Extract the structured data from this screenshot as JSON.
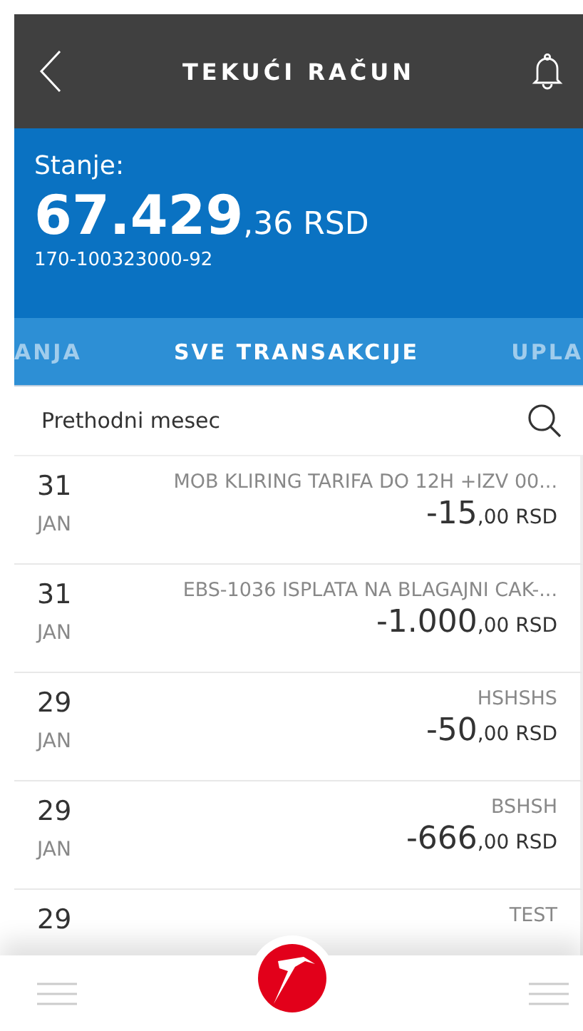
{
  "header": {
    "title": "TEKUĆI RAČUN"
  },
  "balance": {
    "label": "Stanje:",
    "integer": "67.429",
    "decimals": ",36",
    "currency": "RSD",
    "account": "170-100323000-92"
  },
  "tabs": [
    {
      "label": "ANJA",
      "selected": false
    },
    {
      "label": "SVE TRANSAKCIJE",
      "selected": true
    },
    {
      "label": "UPLA",
      "selected": false
    }
  ],
  "filter": {
    "label": "Prethodni mesec"
  },
  "transactions": [
    {
      "day": "31",
      "month": "JAN",
      "description": "MOB KLIRING TARIFA DO 12H +IZV 00...",
      "amount": "-15",
      "decimals": ",00",
      "currency": "RSD"
    },
    {
      "day": "31",
      "month": "JAN",
      "description": "EBS-1036 ISPLATA NA BLAGAJNI CAK-...",
      "amount": "-1.000",
      "decimals": ",00",
      "currency": "RSD"
    },
    {
      "day": "29",
      "month": "JAN",
      "description": "HSHSHS",
      "amount": "-50",
      "decimals": ",00",
      "currency": "RSD"
    },
    {
      "day": "29",
      "month": "JAN",
      "description": "BSHSH",
      "amount": "-666",
      "decimals": ",00",
      "currency": "RSD"
    },
    {
      "day": "29",
      "description": "TEST"
    }
  ]
}
